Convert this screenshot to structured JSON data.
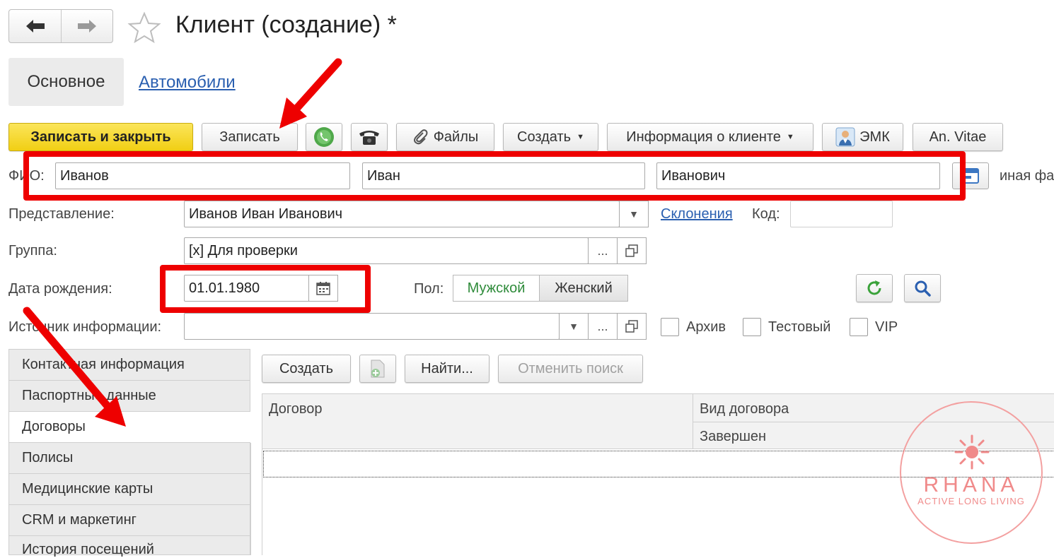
{
  "header": {
    "back_icon": "arrow-left-icon",
    "forward_icon": "arrow-right-icon",
    "favorite_icon": "star-icon",
    "title": "Клиент (создание) *"
  },
  "top_tabs": [
    {
      "label": "Основное",
      "active": true
    },
    {
      "label": "Автомобили",
      "active": false
    }
  ],
  "toolbar": {
    "save_close": "Записать и закрыть",
    "save": "Записать",
    "files": "Файлы",
    "create": "Создать",
    "client_info": "Информация о клиенте",
    "emk": "ЭМК",
    "an_vitae": "An. Vitae"
  },
  "fio": {
    "label": "ФИО:",
    "last_name": "Иванов",
    "first_name": "Иван",
    "middle_name": "Иванович",
    "other_surname": "иная фа"
  },
  "form": {
    "representation_label": "Представление:",
    "representation_value": "Иванов Иван Иванович",
    "declensions_link": "Склонения",
    "code_label": "Код:",
    "code_value": "",
    "group_label": "Группа:",
    "group_value": "[x] Для проверки",
    "ellipsis": "...",
    "birth_label": "Дата рождения:",
    "birth_value": "01.01.1980",
    "gender_label": "Пол:",
    "gender_male": "Мужской",
    "gender_female": "Женский",
    "source_label": "Источник информации:",
    "source_value": "",
    "archive_label": "Архив",
    "test_label": "Тестовый",
    "vip_label": "VIP"
  },
  "side_tabs": [
    {
      "label": "Контактная информация",
      "active": false
    },
    {
      "label": "Паспортные данные",
      "active": false
    },
    {
      "label": "Договоры",
      "active": true
    },
    {
      "label": "Полисы",
      "active": false
    },
    {
      "label": "Медицинские карты",
      "active": false
    },
    {
      "label": "CRM и маркетинг",
      "active": false
    },
    {
      "label": "История посещений",
      "active": false
    }
  ],
  "contracts": {
    "create": "Создать",
    "find": "Найти...",
    "cancel_search": "Отменить поиск",
    "columns": {
      "contract": "Договор",
      "contract_type": "Вид договора",
      "completed": "Завершен"
    }
  },
  "watermark": {
    "brand": "RHANA",
    "tagline": "ACTIVE LONG LIVING"
  },
  "colors": {
    "accent_yellow": "#f3d41c",
    "annotation_red": "#ee0000",
    "link_blue": "#2a5fb0",
    "male_green": "#2e8b3a",
    "watermark_pink": "#f08a8a"
  }
}
